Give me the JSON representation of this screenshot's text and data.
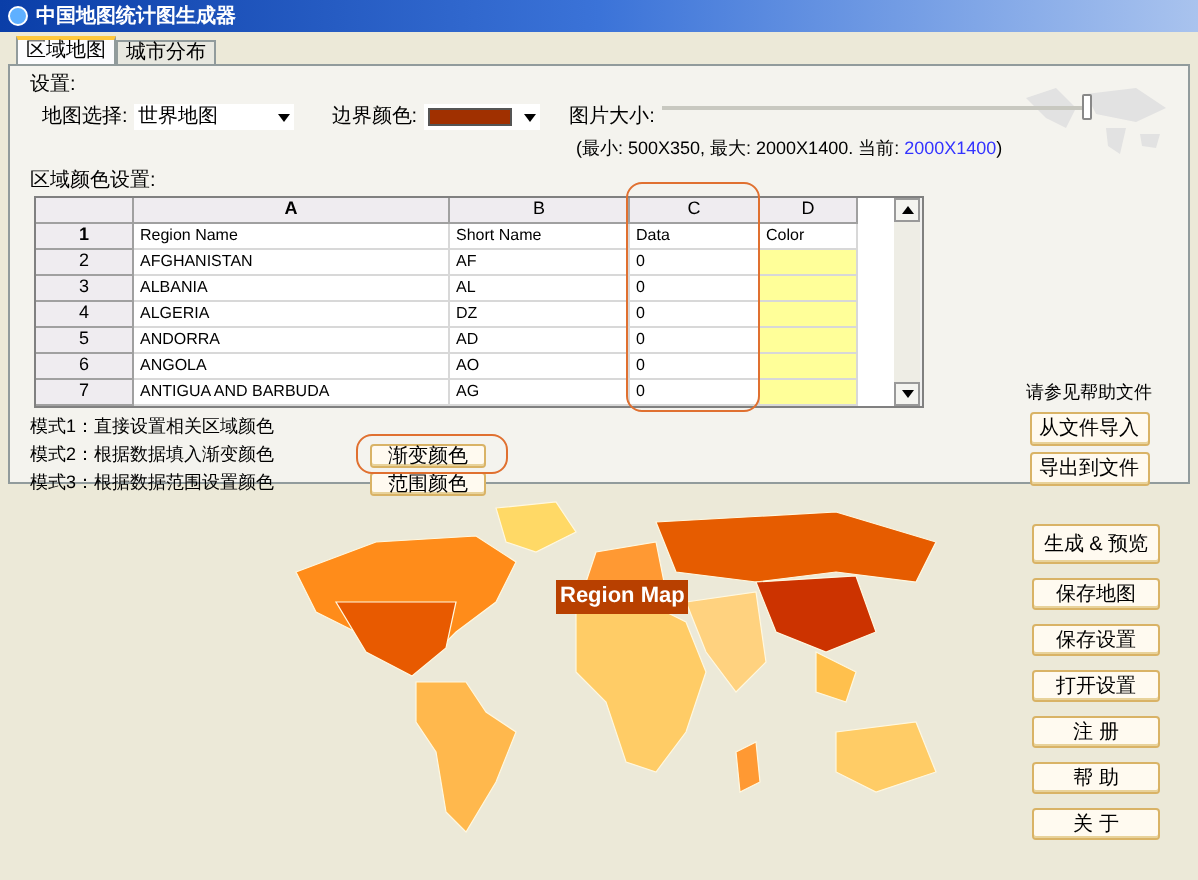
{
  "window": {
    "title": "中国地图统计图生成器"
  },
  "tabs": [
    {
      "label": "区域地图",
      "selected": true
    },
    {
      "label": "城市分布",
      "selected": false
    }
  ],
  "settings": {
    "heading": "设置:",
    "map_label": "地图选择:",
    "map_value": "世界地图",
    "border_label": "边界颜色:",
    "border": {
      "color": "#a03000"
    },
    "size_label": "图片大小:",
    "size_slider": {
      "level": 1
    },
    "size_note": "(最小: 500X350, 最大: 2000X1400. 当前: ",
    "size_current": "2000X1400",
    "size_close": ")"
  },
  "table": {
    "heading": "区域颜色设置:",
    "columns": [
      "A",
      "B",
      "C",
      "D"
    ],
    "header_row": {
      "number": "1",
      "cells": [
        "Region Name",
        "Short Name",
        "Data",
        "Color"
      ]
    },
    "rows": [
      {
        "number": "2",
        "name": "AFGHANISTAN",
        "short": "AF",
        "data": "0",
        "color": "#ffff99"
      },
      {
        "number": "3",
        "name": "ALBANIA",
        "short": "AL",
        "data": "0",
        "color": "#ffff99"
      },
      {
        "number": "4",
        "name": "ALGERIA",
        "short": "DZ",
        "data": "0",
        "color": "#ffff99"
      },
      {
        "number": "5",
        "name": "ANDORRA",
        "short": "AD",
        "data": "0",
        "color": "#ffff99"
      },
      {
        "number": "6",
        "name": "ANGOLA",
        "short": "AO",
        "data": "0",
        "color": "#ffff99"
      },
      {
        "number": "7",
        "name": "ANTIGUA AND BARBUDA",
        "short": "AG",
        "data": "0",
        "color": "#ffff99"
      }
    ]
  },
  "modes": [
    {
      "label": "模式1：直接设置相关区域颜色"
    },
    {
      "label": "模式2：根据数据填入渐变颜色",
      "button": "渐变颜色"
    },
    {
      "label": "模式3：根据数据范围设置颜色",
      "button": "范围颜色"
    }
  ],
  "help": {
    "note": "请参见帮助文件",
    "buttons": [
      "从文件导入",
      "导出到文件"
    ]
  },
  "map_caption": "Region Map",
  "actions": [
    "生成 & 预览",
    "保存地图",
    "保存设置",
    "打开设置",
    "注 册",
    "帮 助",
    "关 于"
  ]
}
